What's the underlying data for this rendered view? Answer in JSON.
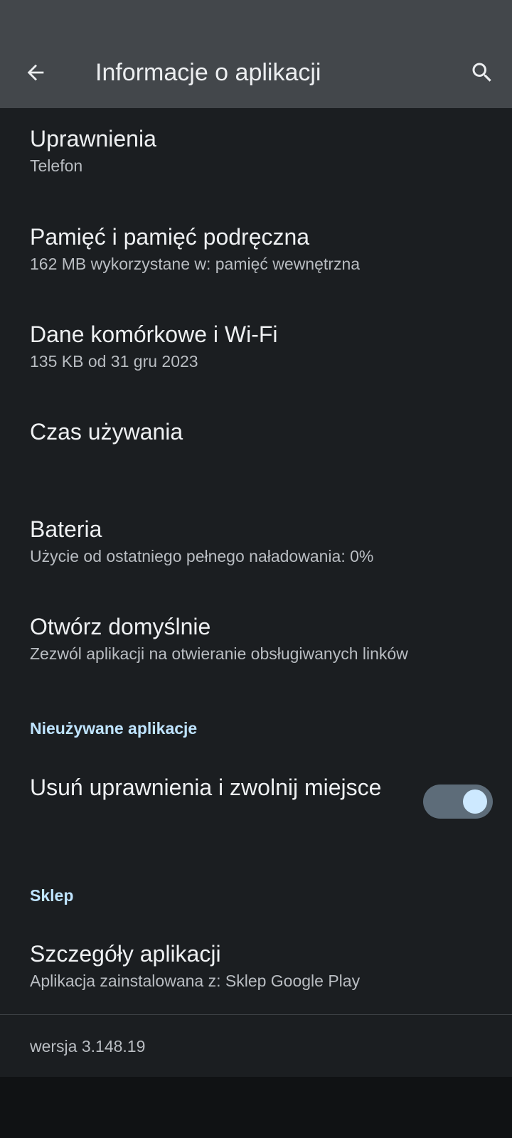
{
  "app_bar": {
    "title": "Informacje o aplikacji",
    "back_icon": "arrow-back-icon",
    "search_icon": "search-icon",
    "background": "#43474b"
  },
  "items": [
    {
      "title": "Uprawnienia",
      "subtitle": "Telefon"
    },
    {
      "title": "Pamięć i pamięć podręczna",
      "subtitle": "162 MB wykorzystane w: pamięć wewnętrzna"
    },
    {
      "title": "Dane komórkowe i Wi-Fi",
      "subtitle": "135 KB od 31 gru 2023"
    },
    {
      "title": "Czas używania",
      "subtitle": ""
    },
    {
      "title": "Bateria",
      "subtitle": "Użycie od ostatniego pełnego naładowania: 0%"
    },
    {
      "title": "Otwórz domyślnie",
      "subtitle": "Zezwól aplikacji na otwieranie obsługiwanych linków"
    }
  ],
  "unused_section": {
    "header": "Nieużywane aplikacje",
    "toggle_title": "Usuń uprawnienia i zwolnij miejsce",
    "toggle_on": true
  },
  "store_section": {
    "header": "Sklep",
    "title": "Szczegóły aplikacji",
    "subtitle": "Aplikacja zainstalowana z: Sklep Google Play"
  },
  "version_text": "wersja 3.148.19",
  "colors": {
    "background": "#1b1e21",
    "accent": "#bfe4ff",
    "switch_track": "#5d6c79",
    "switch_thumb": "#cde9ff"
  }
}
